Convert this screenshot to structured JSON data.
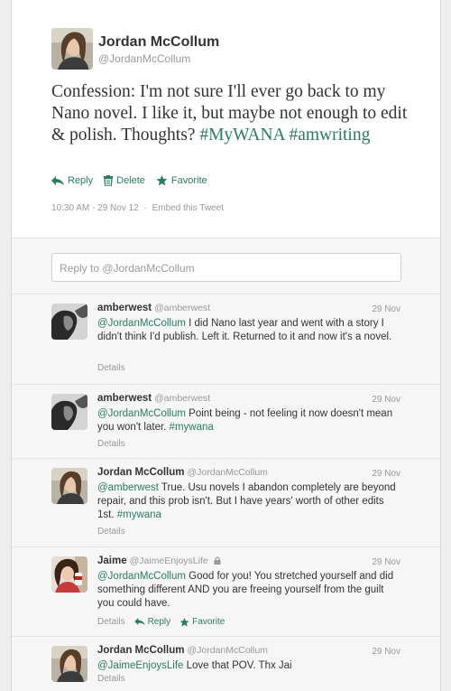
{
  "colors": {
    "accent": "#2a7b63",
    "muted": "#999999",
    "text": "#333333"
  },
  "main_tweet": {
    "fullname": "Jordan McCollum",
    "username": "@JordanMcCollum",
    "text": "Confession: I'm not sure I'll ever go back to my Nano novel. I like it, but maybe not enough to edit & polish. Thoughts?",
    "hashtag1": "#MyWANA",
    "hashtag2": "#amwriting",
    "actions": {
      "reply": "Reply",
      "delete": "Delete",
      "favorite": "Favorite"
    },
    "timestamp": "10:30 AM - 29 Nov 12",
    "separator": "·",
    "embed": "Embed this Tweet"
  },
  "reply_box": {
    "placeholder": "Reply to @JordanMcCollum"
  },
  "replies": [
    {
      "fullname": "amberwest",
      "username": "@amberwest",
      "date": "29 Nov",
      "mention": "@JordanMcCollum",
      "text": " I did Nano last year and went with a story I didn't think I'd publish. Left it. Returned to it and now it's a novel.",
      "hashtag": "",
      "details": "Details"
    },
    {
      "fullname": "amberwest",
      "username": "@amberwest",
      "date": "29 Nov",
      "mention": "@JordanMcCollum",
      "text": " Point being - not feeling it now doesn't mean you won't later. ",
      "hashtag": "#mywana",
      "details": "Details"
    },
    {
      "fullname": "Jordan McCollum",
      "username": "@JordanMcCollum",
      "date": "29 Nov",
      "mention": "@amberwest",
      "text": " True. Usu novels I abandon completely are beyond repair, and this prob isn't. But I have years' worth of other edits 1st. ",
      "hashtag": "#mywana",
      "details": "Details"
    },
    {
      "fullname": "Jaime",
      "username": "@JaimeEnjoysLife",
      "date": "29 Nov",
      "mention": "@JordanMcCollum",
      "text": " Good for you! You stretched yourself and did something different AND you are freeing yourself from the guilt you could have.",
      "hashtag": "",
      "details": "Details",
      "reply": "Reply",
      "favorite": "Favorite"
    },
    {
      "fullname": "Jordan McCollum",
      "username": "@JordanMcCollum",
      "date": "29 Nov",
      "mention": "@JaimeEnjoysLife",
      "text": " Love that POV. Thx Jai",
      "hashtag": "",
      "details": "Details"
    }
  ]
}
